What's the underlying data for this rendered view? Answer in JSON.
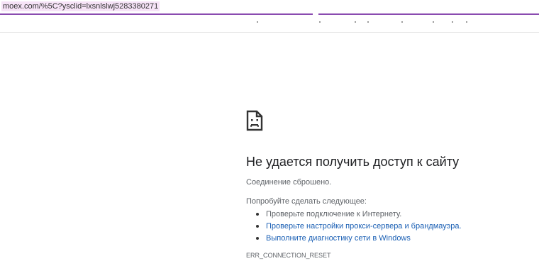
{
  "address_bar": {
    "url": "moex.com/%5C?ysclid=lxsnlslwj5283380271"
  },
  "error": {
    "icon": "sad-page-icon",
    "title": "Не удается получить доступ к сайту",
    "subtitle": "Соединение сброшено.",
    "suggestions_header": "Попробуйте сделать следующее:",
    "suggestions": [
      {
        "text": "Проверьте подключение к Интернету.",
        "is_link": false
      },
      {
        "text": "Проверьте настройки прокси-сервера и брандмауэра.",
        "is_link": true
      },
      {
        "text": "Выполните диагностику сети в Windows",
        "is_link": true
      }
    ],
    "code": "ERR_CONNECTION_RESET"
  },
  "colors": {
    "address_underline": "#8a4bb0",
    "url_highlight": "#f6e3f7",
    "link": "#1a5fb4",
    "text_secondary": "#5f6368",
    "title": "#202124"
  }
}
